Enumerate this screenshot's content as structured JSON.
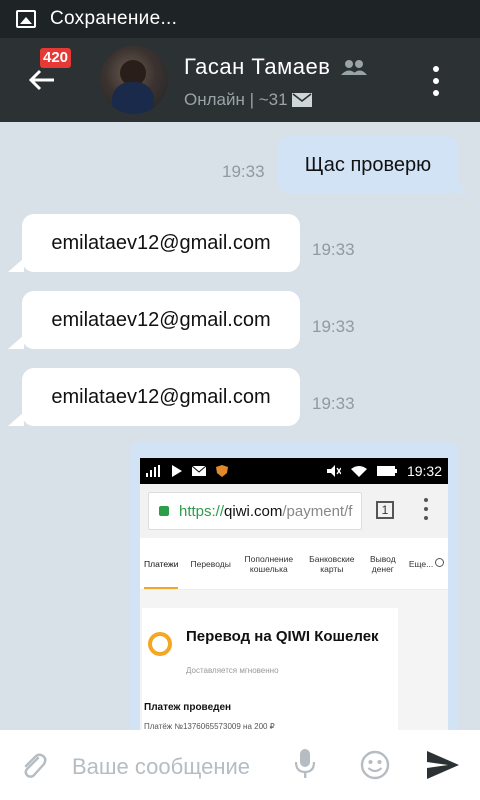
{
  "status_bar": {
    "text": "Сохранение...",
    "icon": "image-icon"
  },
  "header": {
    "unread_badge": "420",
    "name": "Гасан Тамаев",
    "status": "Онлайн | ~31",
    "back_icon": "back-arrow-icon",
    "group_icon": "group-icon",
    "mail_icon": "mail-icon",
    "menu_icon": "more-vert-icon"
  },
  "messages": [
    {
      "direction": "outgoing",
      "text": "Щас проверю",
      "time": "19:33"
    },
    {
      "direction": "incoming",
      "text": "emilataev12@gmail.com",
      "time": "19:33"
    },
    {
      "direction": "incoming",
      "text": "emilataev12@gmail.com",
      "time": "19:33"
    },
    {
      "direction": "incoming",
      "text": "emilataev12@gmail.com",
      "time": "19:33"
    }
  ],
  "attachment_screenshot": {
    "clock": "19:32",
    "url_https": "https://",
    "url_domain": "qiwi.com",
    "url_path": "/payment/f",
    "tab_count": "1",
    "nav": [
      "Платежи",
      "Переводы",
      "Пополнение кошелька",
      "Банковские карты",
      "Вывод денег",
      "Еще..."
    ],
    "card_title": "Перевод на QIWI Кошелек",
    "card_subtitle": "Доставляется мгновенно",
    "payment_status": "Платеж проведен",
    "payment_detail": "Платёж №1376065573009 на 200 ₽"
  },
  "composer": {
    "placeholder": "Ваше сообщение",
    "attach_icon": "paperclip-icon",
    "mic_icon": "microphone-icon",
    "emoji_icon": "smile-icon",
    "send_icon": "send-icon"
  },
  "colors": {
    "appbar": "#2c3134",
    "chat_bg": "#d8e0e8",
    "outgoing_bubble": "#d2e3f6",
    "incoming_bubble": "#ffffff",
    "badge": "#e53935"
  }
}
